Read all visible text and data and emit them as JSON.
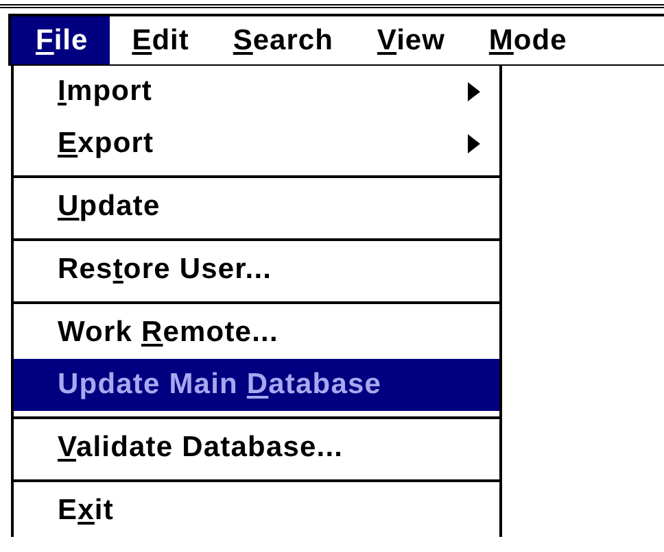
{
  "menubar": [
    {
      "key": "F",
      "after": "ile",
      "selected": true
    },
    {
      "key": "E",
      "after": "dit",
      "selected": false
    },
    {
      "key": "S",
      "after": "earch",
      "selected": false
    },
    {
      "key": "V",
      "after": "iew",
      "selected": false
    },
    {
      "key": "M",
      "after": "ode",
      "selected": false
    }
  ],
  "menu": {
    "groups": [
      [
        {
          "key": "I",
          "after": "mport",
          "submenu": true,
          "selected": false,
          "disabled": false
        },
        {
          "key": "E",
          "after": "xport",
          "submenu": true,
          "selected": false,
          "disabled": false
        }
      ],
      [
        {
          "key": "U",
          "after": "pdate",
          "submenu": false,
          "selected": false,
          "disabled": false
        }
      ],
      [
        {
          "before": "Res",
          "key": "t",
          "after": "ore User...",
          "submenu": false,
          "selected": false,
          "disabled": false
        }
      ],
      [
        {
          "before": "Work ",
          "key": "R",
          "after": "emote...",
          "submenu": false,
          "selected": false,
          "disabled": false
        },
        {
          "before": "Update Main ",
          "key": "D",
          "after": "atabase",
          "submenu": false,
          "selected": true,
          "disabled": true
        }
      ],
      [
        {
          "key": "V",
          "after": "alidate Database...",
          "submenu": false,
          "selected": false,
          "disabled": false
        }
      ],
      [
        {
          "before": "E",
          "key": "x",
          "after": "it",
          "submenu": false,
          "selected": false,
          "disabled": false
        }
      ]
    ]
  }
}
